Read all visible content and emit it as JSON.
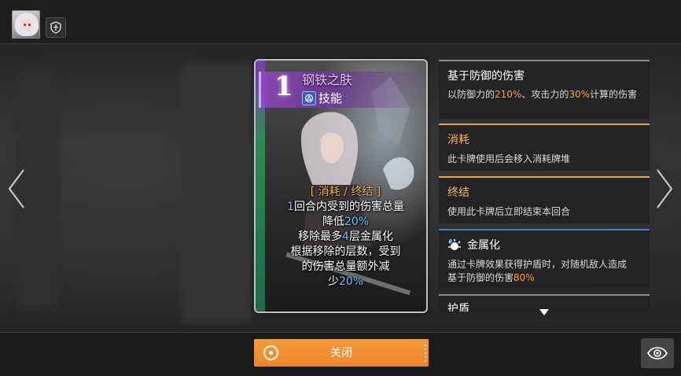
{
  "top_bar": {
    "avatar": "character-avatar",
    "shield_icon": "shield-icon"
  },
  "card": {
    "cost": "1",
    "name": "钢铁之肤",
    "type": "技能",
    "type_icon": "skill-icon",
    "description": {
      "tags": "[ 消耗 / 终结 ]",
      "line1_a": "1",
      "line1_b": "回合内受到的伤害总量",
      "line2_a": "降低",
      "line2_b": "20%",
      "line3_a": "移除最多",
      "line3_b": "4",
      "line3_c": "层金属化",
      "line4": "根据移除的层数，受到",
      "line5": "的伤害总量额外减",
      "line6_a": "少",
      "line6_b": "20%"
    }
  },
  "keywords": [
    {
      "title": "基于防御的伤害",
      "desc_a": "以防御力的",
      "desc_b": "210%",
      "desc_c": "、攻击力的",
      "desc_d": "30%",
      "desc_e": "计算的伤害"
    },
    {
      "title": "消耗",
      "desc": "此卡牌使用后会移入消耗牌堆"
    },
    {
      "title": "终结",
      "desc": "使用此卡牌后立即结束本回合"
    },
    {
      "title": "金属化",
      "icon": "metallize-icon",
      "desc_line1": "通过卡牌效果获得护盾时，对随机敌人造成",
      "desc_line2_a": "基于防御的伤害",
      "desc_line2_b": "80%"
    },
    {
      "title": "护盾"
    }
  ],
  "bottom": {
    "close_label": "关闭",
    "eye_icon": "eye-icon"
  },
  "colors": {
    "accent_orange": "#ef8628",
    "highlight_blue": "#63c3ff",
    "highlight_orange": "#f3a23c"
  }
}
